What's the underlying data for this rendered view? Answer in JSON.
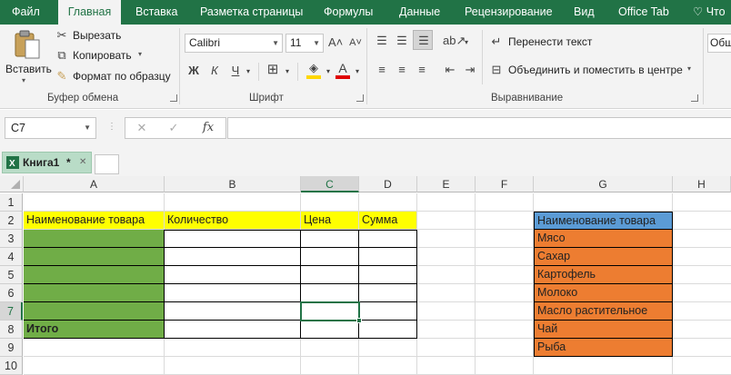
{
  "tabs": [
    "Файл",
    "Главная",
    "Вставка",
    "Разметка страницы",
    "Формулы",
    "Данные",
    "Рецензирование",
    "Вид",
    "Office Tab",
    "Что"
  ],
  "active_tab": "Главная",
  "clipboard": {
    "paste": "Вставить",
    "cut": "Вырезать",
    "copy": "Копировать",
    "format_painter": "Формат по образцу",
    "title": "Буфер обмена"
  },
  "font": {
    "name": "Calibri",
    "size": "11",
    "grow": "A˄",
    "shrink": "A˅",
    "bold": "Ж",
    "italic": "К",
    "underline": "Ч",
    "font_color_letter": "A",
    "title": "Шрифт",
    "accent_fill": "#ffd700",
    "accent_font": "#e00000"
  },
  "alignment": {
    "wrap_text": "Перенести текст",
    "merge_center": "Объединить и поместить в центре",
    "title": "Выравнивание"
  },
  "number": {
    "format": "Общ"
  },
  "formula_bar": {
    "name_box": "C7",
    "cancel": "✕",
    "enter": "✓",
    "fx": "fx",
    "formula": ""
  },
  "workbook": {
    "tab_name": "Книга1",
    "modified": "*",
    "close": "✕"
  },
  "columns": [
    "A",
    "B",
    "C",
    "D",
    "E",
    "F",
    "G",
    "H"
  ],
  "rows": [
    "1",
    "2",
    "3",
    "4",
    "5",
    "6",
    "7",
    "8",
    "9",
    "10"
  ],
  "selected_column": "C",
  "selected_row": "7",
  "headers": {
    "a2": "Наименование товара",
    "b2": "Количество",
    "c2": "Цена",
    "d2": "Сумма",
    "g2": "Наименование товара"
  },
  "total_label": "Итого",
  "products": [
    "Мясо",
    "Сахар",
    "Картофель",
    "Молоко",
    "Масло растительное",
    "Чай",
    "Рыба"
  ],
  "colors": {
    "excel_green": "#217346",
    "yellow": "#ffff00",
    "green": "#70ad47",
    "orange": "#ed7d31",
    "blue": "#5b9bd5"
  }
}
